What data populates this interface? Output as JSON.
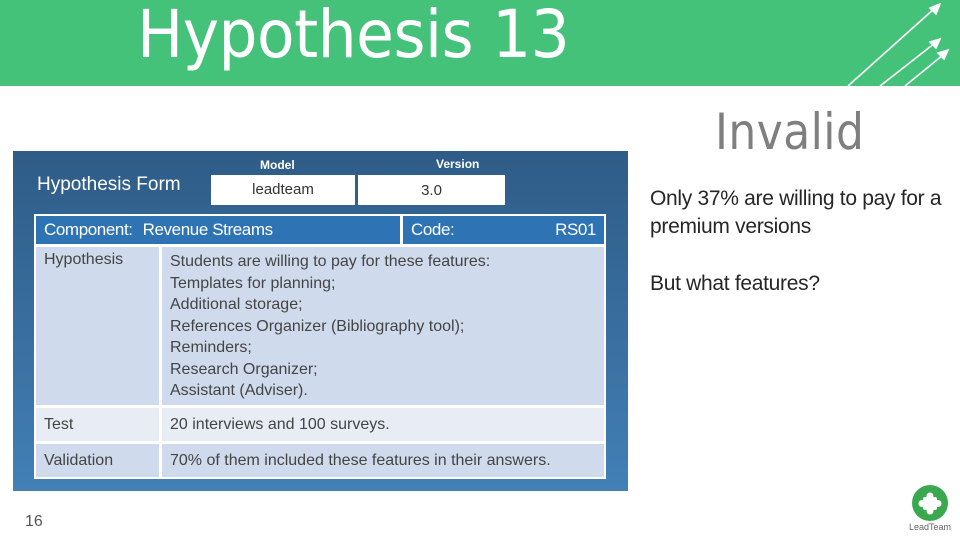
{
  "slide": {
    "title": "Hypothesis 13",
    "page_number": "16",
    "colors": {
      "header_green": "#44c27a",
      "header_triangle": "#3a9a62",
      "panel_blue": "#2f5c87",
      "table_header_blue": "#2e74b5",
      "row_dark": "#cfdbec",
      "row_light": "#e8edf5",
      "status_gray": "#7f7f7f",
      "logo_green": "#3aa84e"
    },
    "icons": {
      "header_decor": "triangle-icon",
      "header_arrows": "growth-arrows-icon",
      "logo": "puzzle-piece-icon"
    }
  },
  "form": {
    "title": "Hypothesis Form",
    "model_label": "Model",
    "model_value": "leadteam",
    "version_label": "Version",
    "version_value": "3.0",
    "component_label": "Component:",
    "component_value": "Revenue Streams",
    "code_label": "Code:",
    "code_value": "RS01",
    "rows": [
      {
        "label": "Hypothesis",
        "lines": [
          "Students are willing to pay for these features:",
          "Templates for planning;",
          "Additional storage;",
          "References Organizer (Bibliography tool);",
          "Reminders;",
          "Research Organizer;",
          "Assistant (Adviser)."
        ]
      },
      {
        "label": "Test",
        "value": "20 interviews and 100 surveys."
      },
      {
        "label": "Validation",
        "value": "70% of them included these features in their answers."
      }
    ]
  },
  "result": {
    "status": "Invalid",
    "finding": "Only 37% are willing to pay for a premium versions",
    "question": "But what features?"
  },
  "logo": {
    "text": "LeadTeam"
  }
}
